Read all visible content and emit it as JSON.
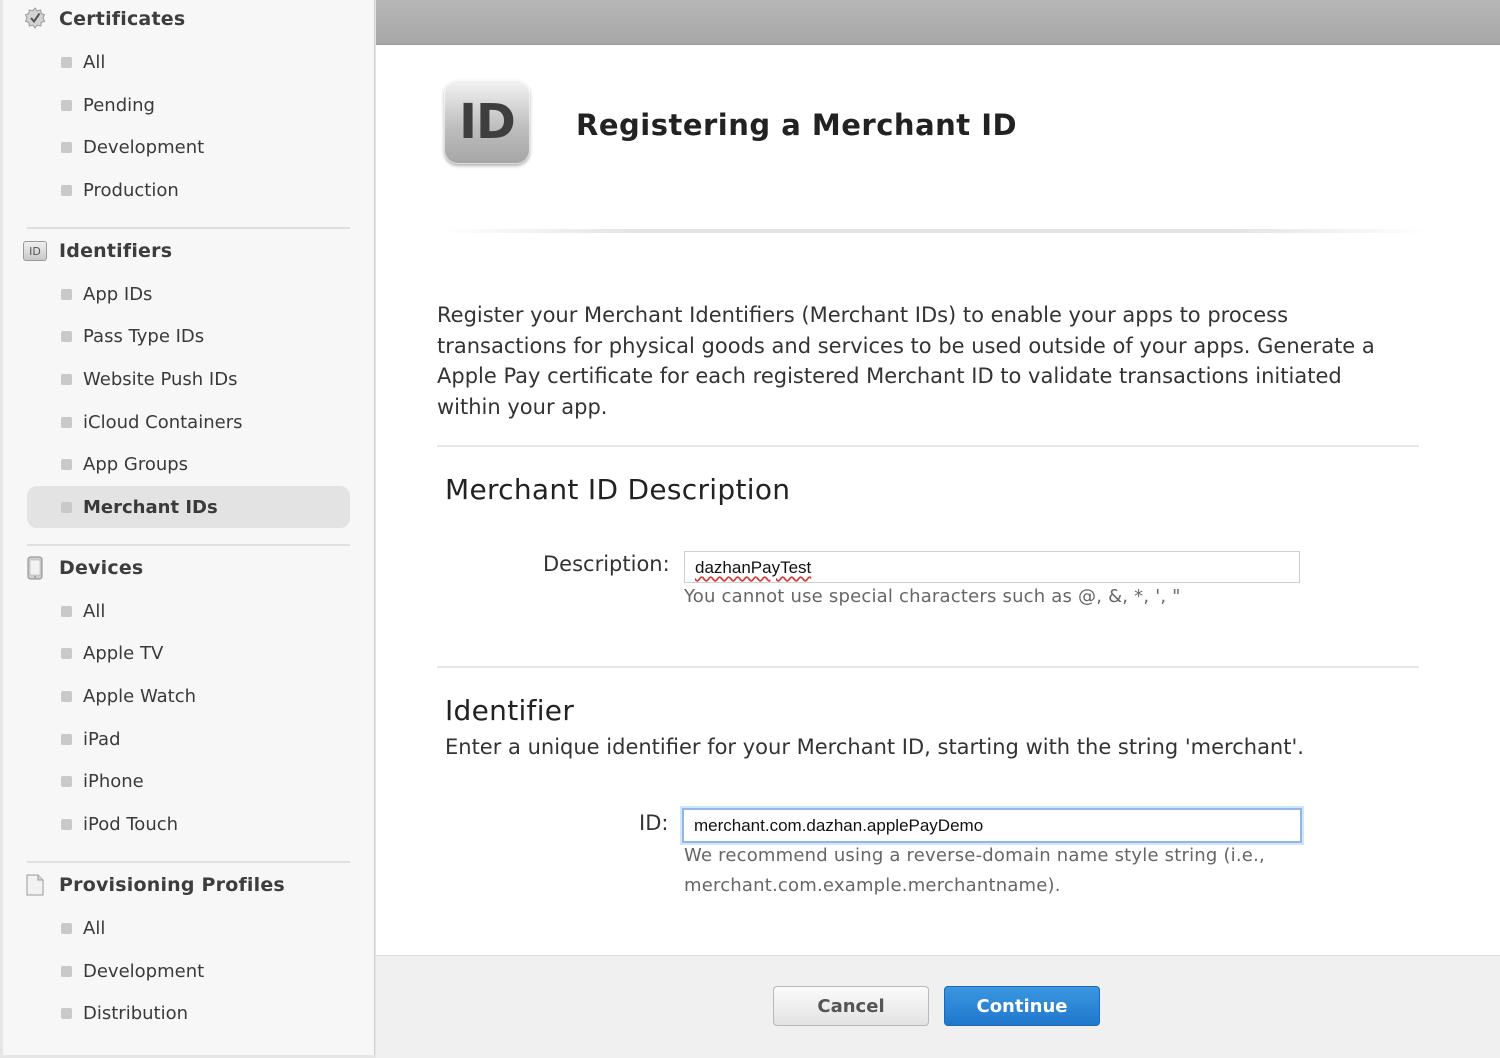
{
  "sidebar": {
    "certificates": {
      "label": "Certificates",
      "items": [
        "All",
        "Pending",
        "Development",
        "Production"
      ]
    },
    "identifiers": {
      "label": "Identifiers",
      "icon_text": "ID",
      "items": [
        "App IDs",
        "Pass Type IDs",
        "Website Push IDs",
        "iCloud Containers",
        "App Groups",
        "Merchant IDs"
      ],
      "active": "Merchant IDs"
    },
    "devices": {
      "label": "Devices",
      "items": [
        "All",
        "Apple TV",
        "Apple Watch",
        "iPad",
        "iPhone",
        "iPod Touch"
      ]
    },
    "provisioning": {
      "label": "Provisioning Profiles",
      "items": [
        "All",
        "Development",
        "Distribution"
      ]
    }
  },
  "page": {
    "badge_text": "ID",
    "title": "Registering a Merchant ID",
    "intro": "Register your Merchant Identifiers (Merchant IDs) to enable your apps to process transactions for physical goods and services to be used outside of your apps. Generate a Apple Pay certificate for each registered Merchant ID to validate transactions initiated within your app."
  },
  "description_section": {
    "heading": "Merchant ID Description",
    "field_label": "Description:",
    "value": "dazhanPayTest",
    "help": "You cannot use special characters such as @, &, *, ', \""
  },
  "identifier_section": {
    "heading": "Identifier",
    "subtitle": "Enter a unique identifier for your Merchant ID, starting with the string 'merchant'.",
    "field_label": "ID:",
    "value": "merchant.com.dazhan.applePayDemo",
    "help_line1": "We recommend using a reverse-domain name style string (i.e.,",
    "help_line2": "merchant.com.example.merchantname)."
  },
  "footer": {
    "cancel_label": "Cancel",
    "continue_label": "Continue"
  },
  "colors": {
    "accent": "#1f77cc",
    "sidebar_bg": "#f7f7f7",
    "topbar": "#adadad"
  }
}
